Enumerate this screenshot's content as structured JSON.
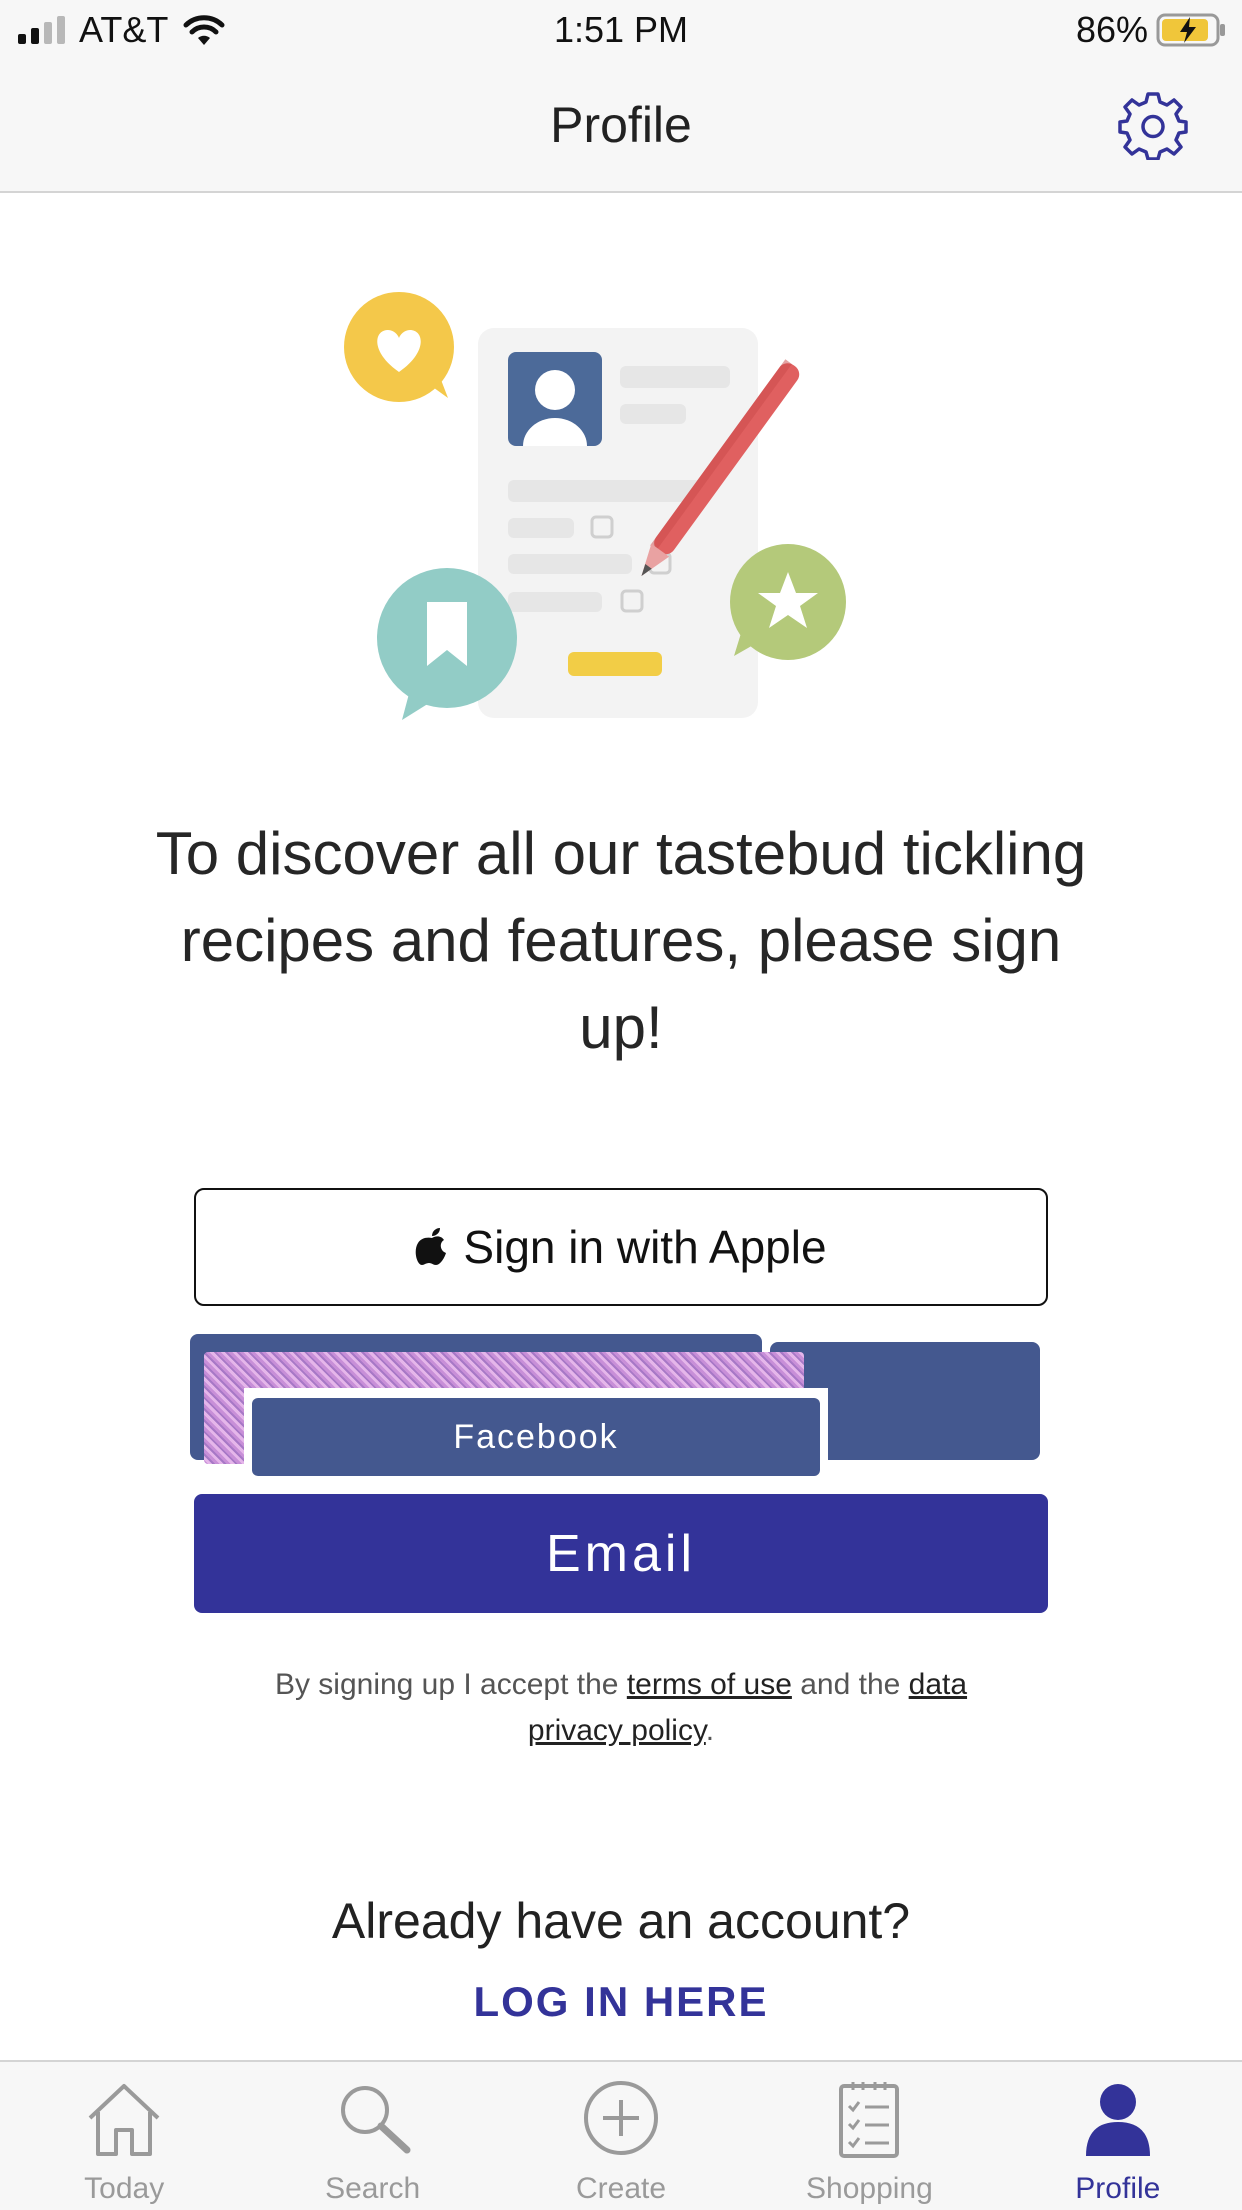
{
  "status_bar": {
    "carrier": "AT&T",
    "time": "1:51 PM",
    "battery": "86%"
  },
  "header": {
    "title": "Profile"
  },
  "main": {
    "headline": "To discover all our tastebud tickling recipes and features, please sign up!",
    "apple_button": "Sign in with Apple",
    "facebook_button": "Facebook",
    "email_button": "Email",
    "terms": {
      "prefix": "By signing up I accept the ",
      "terms_link": "terms of use",
      "middle": " and the ",
      "privacy_link": "data privacy policy",
      "suffix": "."
    },
    "already_account": "Already have an account?",
    "login_link": "LOG IN HERE"
  },
  "tabbar": {
    "items": [
      {
        "label": "Today",
        "icon": "home-icon"
      },
      {
        "label": "Search",
        "icon": "search-icon"
      },
      {
        "label": "Create",
        "icon": "plus-circle-icon"
      },
      {
        "label": "Shopping",
        "icon": "checklist-icon"
      },
      {
        "label": "Profile",
        "icon": "person-icon"
      }
    ],
    "active_index": 4
  },
  "colors": {
    "primary": "#333399",
    "facebook": "#44588f",
    "inactive_tab": "#9a9a9a"
  }
}
